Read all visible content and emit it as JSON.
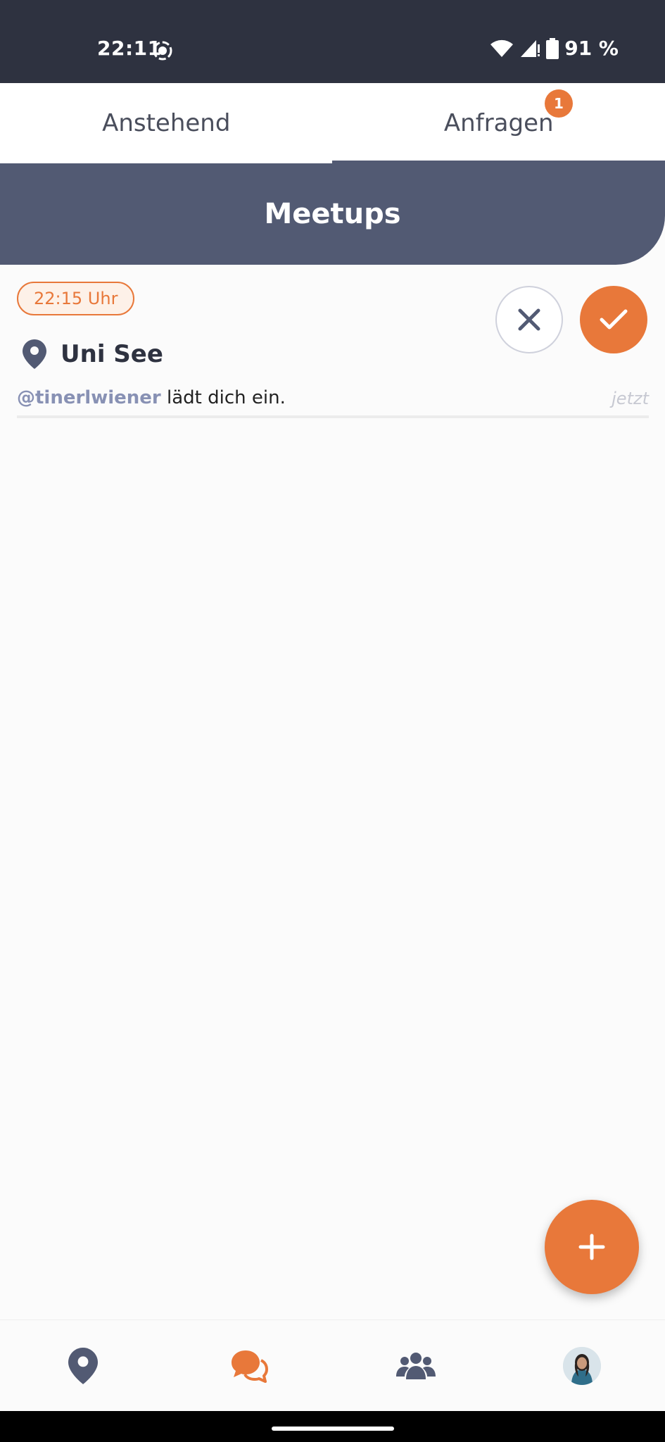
{
  "status_bar": {
    "time": "22:11",
    "battery": "91 %",
    "icons": [
      "screen-record-icon",
      "wifi-icon",
      "signal-icon",
      "battery-icon"
    ]
  },
  "tabs": [
    {
      "label": "Anstehend",
      "active": false
    },
    {
      "label": "Anfragen",
      "active": true,
      "badge": "1"
    }
  ],
  "header": {
    "title": "Meetups"
  },
  "invitation": {
    "time_label": "22:15 Uhr",
    "location": "Uni See",
    "user": "@tinerlwiener",
    "message": " lädt dich ein.",
    "timestamp": "jetzt",
    "decline_icon": "close-icon",
    "accept_icon": "check-icon"
  },
  "fab": {
    "icon": "plus-icon"
  },
  "bottom_nav": {
    "items": [
      "map-pin-icon",
      "chat-icon",
      "group-icon",
      "profile-avatar"
    ],
    "active_index": 1
  },
  "colors": {
    "accent": "#e8783a",
    "header": "#525a73",
    "status_bar": "#2e3240"
  }
}
